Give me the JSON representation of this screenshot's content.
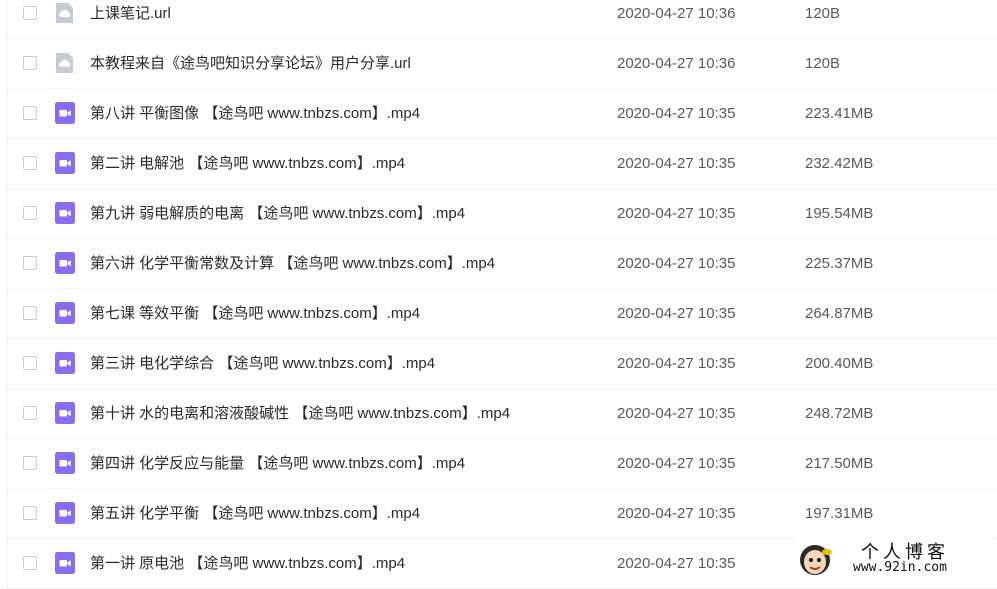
{
  "files": [
    {
      "name": "上课笔记.url",
      "date": "2020-04-27 10:36",
      "size": "120B",
      "type": "link"
    },
    {
      "name": "本教程来自《途鸟吧知识分享论坛》用户分享.url",
      "date": "2020-04-27 10:36",
      "size": "120B",
      "type": "link"
    },
    {
      "name": "第八讲 平衡图像 【途鸟吧 www.tnbzs.com】.mp4",
      "date": "2020-04-27 10:35",
      "size": "223.41MB",
      "type": "video"
    },
    {
      "name": "第二讲 电解池 【途鸟吧 www.tnbzs.com】.mp4",
      "date": "2020-04-27 10:35",
      "size": "232.42MB",
      "type": "video"
    },
    {
      "name": "第九讲 弱电解质的电离 【途鸟吧 www.tnbzs.com】.mp4",
      "date": "2020-04-27 10:35",
      "size": "195.54MB",
      "type": "video"
    },
    {
      "name": "第六讲 化学平衡常数及计算 【途鸟吧 www.tnbzs.com】.mp4",
      "date": "2020-04-27 10:35",
      "size": "225.37MB",
      "type": "video"
    },
    {
      "name": "第七课 等效平衡 【途鸟吧 www.tnbzs.com】.mp4",
      "date": "2020-04-27 10:35",
      "size": "264.87MB",
      "type": "video"
    },
    {
      "name": "第三讲 电化学综合 【途鸟吧 www.tnbzs.com】.mp4",
      "date": "2020-04-27 10:35",
      "size": "200.40MB",
      "type": "video"
    },
    {
      "name": "第十讲 水的电离和溶液酸碱性 【途鸟吧 www.tnbzs.com】.mp4",
      "date": "2020-04-27 10:35",
      "size": "248.72MB",
      "type": "video"
    },
    {
      "name": "第四讲 化学反应与能量 【途鸟吧 www.tnbzs.com】.mp4",
      "date": "2020-04-27 10:35",
      "size": "217.50MB",
      "type": "video"
    },
    {
      "name": "第五讲 化学平衡 【途鸟吧 www.tnbzs.com】.mp4",
      "date": "2020-04-27 10:35",
      "size": "197.31MB",
      "type": "video"
    },
    {
      "name": "第一讲 原电池 【途鸟吧 www.tnbzs.com】.mp4",
      "date": "2020-04-27 10:35",
      "size": "",
      "type": "video"
    }
  ],
  "icons": {
    "link": "cloud-link-file-icon",
    "video": "video-file-icon"
  },
  "colors": {
    "link_icon": "#c3cbd6",
    "video_icon": "#8b6cf0"
  },
  "watermark": {
    "title": "个人博客",
    "url": "www.92in.com"
  }
}
